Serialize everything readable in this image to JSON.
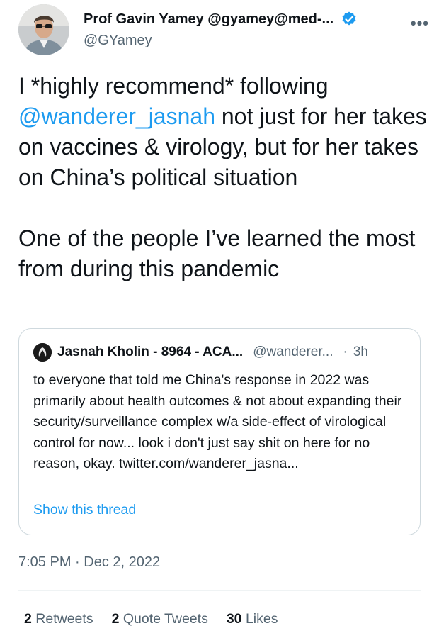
{
  "author": {
    "display_name": "Prof Gavin Yamey @gyamey@med-...",
    "handle": "@GYamey"
  },
  "more_icon": "more-horizontal-icon",
  "tweet": {
    "text_before_mention": "I *highly recommend* following ",
    "mention": "@wanderer_jasnah",
    "text_after_mention": " not just for her takes on vaccines & virology, but for her takes on China’s political situation",
    "paragraph2": "One of the people I’ve learned the most from during this pandemic"
  },
  "quoted_tweet": {
    "display_name": "Jasnah Kholin - 8964 - ACA...",
    "handle": "@wanderer...",
    "separator": "·",
    "time": "3h",
    "text": "to everyone that told me China's response in 2022 was primarily about health outcomes & not about expanding their security/surveillance complex w/a side-effect of virological control for now... look i don't just say shit on here for no reason, okay. twitter.com/wanderer_jasna...",
    "show_thread": "Show this thread"
  },
  "timestamp": "7:05 PM · Dec 2, 2022",
  "stats": {
    "retweets_count": "2",
    "retweets_label": "Retweets",
    "quotes_count": "2",
    "quotes_label": "Quote Tweets",
    "likes_count": "30",
    "likes_label": "Likes"
  },
  "colors": {
    "link": "#1d9bf0",
    "secondary_text": "#536471",
    "primary_text": "#0f1419",
    "border": "#cfd9de"
  }
}
